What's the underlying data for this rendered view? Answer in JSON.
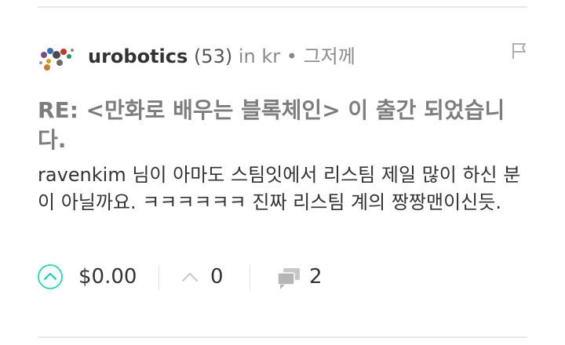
{
  "post": {
    "author": "urobotics",
    "reputation": "(53)",
    "community": "in kr",
    "bullet": "•",
    "time": "그저께",
    "title": "RE: <만화로 배우는 블록체인> 이 출간 되었습니다.",
    "body": "ravenkim 님이 아마도 스팀잇에서 리스팀 제일 많이 하신 분이 아닐까요. ㅋㅋㅋㅋㅋㅋ 진짜 리스팀 계의 짱짱맨이신듯."
  },
  "footer": {
    "payout": "$0.00",
    "votes": "0",
    "comments": "2"
  },
  "icons": {
    "flag": "flag-icon",
    "upvote": "upvote-icon",
    "upvote_small": "chevron-up-icon",
    "comments": "comments-icon"
  },
  "colors": {
    "accent": "#06d6a9",
    "title": "#7d7d7d",
    "meta": "#8a8a8a",
    "icon": "#c8c8c8"
  }
}
